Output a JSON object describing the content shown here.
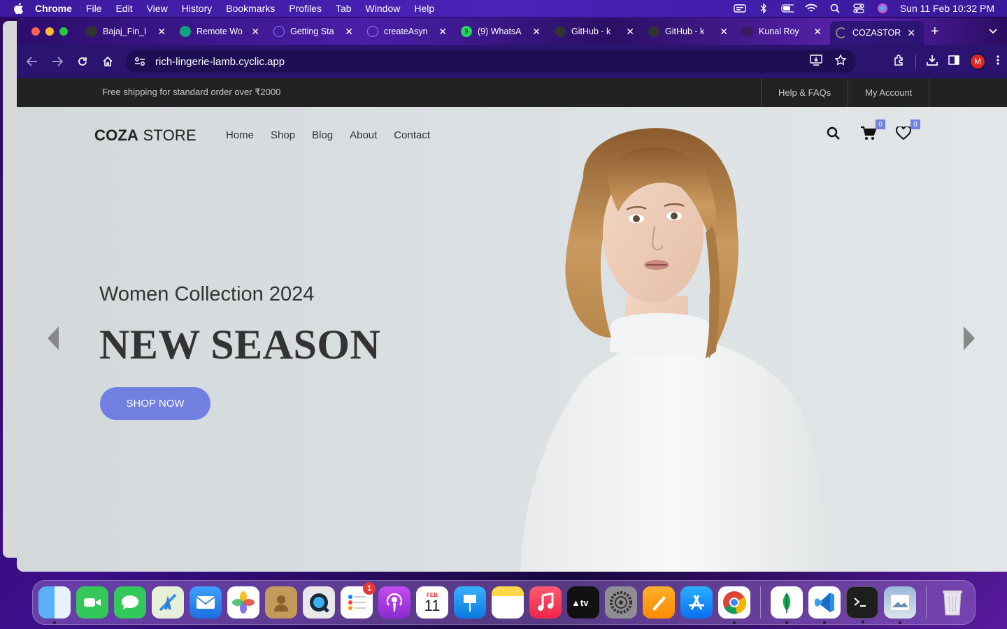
{
  "menubar": {
    "app_name": "Chrome",
    "items": [
      "File",
      "Edit",
      "View",
      "History",
      "Bookmarks",
      "Profiles",
      "Tab",
      "Window",
      "Help"
    ],
    "clock": "Sun 11 Feb  10:32 PM"
  },
  "tabs": [
    {
      "label": "Bajaj_Fin_l",
      "icon": "github-icon"
    },
    {
      "label": "Remote Wo",
      "icon": "openai-icon"
    },
    {
      "label": "Getting Sta",
      "icon": "redux-icon"
    },
    {
      "label": "createAsyn",
      "icon": "redux-icon"
    },
    {
      "label": "(9) WhatsA",
      "icon": "whatsapp-icon"
    },
    {
      "label": "GitHub - k",
      "icon": "github-icon"
    },
    {
      "label": "GitHub - k",
      "icon": "github-icon"
    },
    {
      "label": "Kunal Roy",
      "icon": "site-icon"
    },
    {
      "label": "COZASTOR",
      "icon": "loading-icon"
    }
  ],
  "address": {
    "url": "rich-lingerie-lamb.cyclic.app"
  },
  "profile": {
    "initial": "M"
  },
  "site": {
    "topbar": {
      "shipping": "Free shipping for standard order over ₹2000",
      "links": [
        "Help & FAQs",
        "My Account"
      ]
    },
    "logo_bold": "COZA",
    "logo_light": " STORE",
    "nav": [
      "Home",
      "Shop",
      "Blog",
      "About",
      "Contact"
    ],
    "cart_count": "0",
    "wishlist_count": "0",
    "hero": {
      "subtitle": "Women Collection 2024",
      "headline": "NEW SEASON",
      "cta": "SHOP NOW"
    }
  },
  "dock": {
    "reminders_badge": "1",
    "calendar_month": "FEB",
    "calendar_day": "11"
  },
  "colors": {
    "accent": "#717fe0",
    "topbar_bg": "#222222",
    "hero_bg": "#dfe3e6"
  }
}
